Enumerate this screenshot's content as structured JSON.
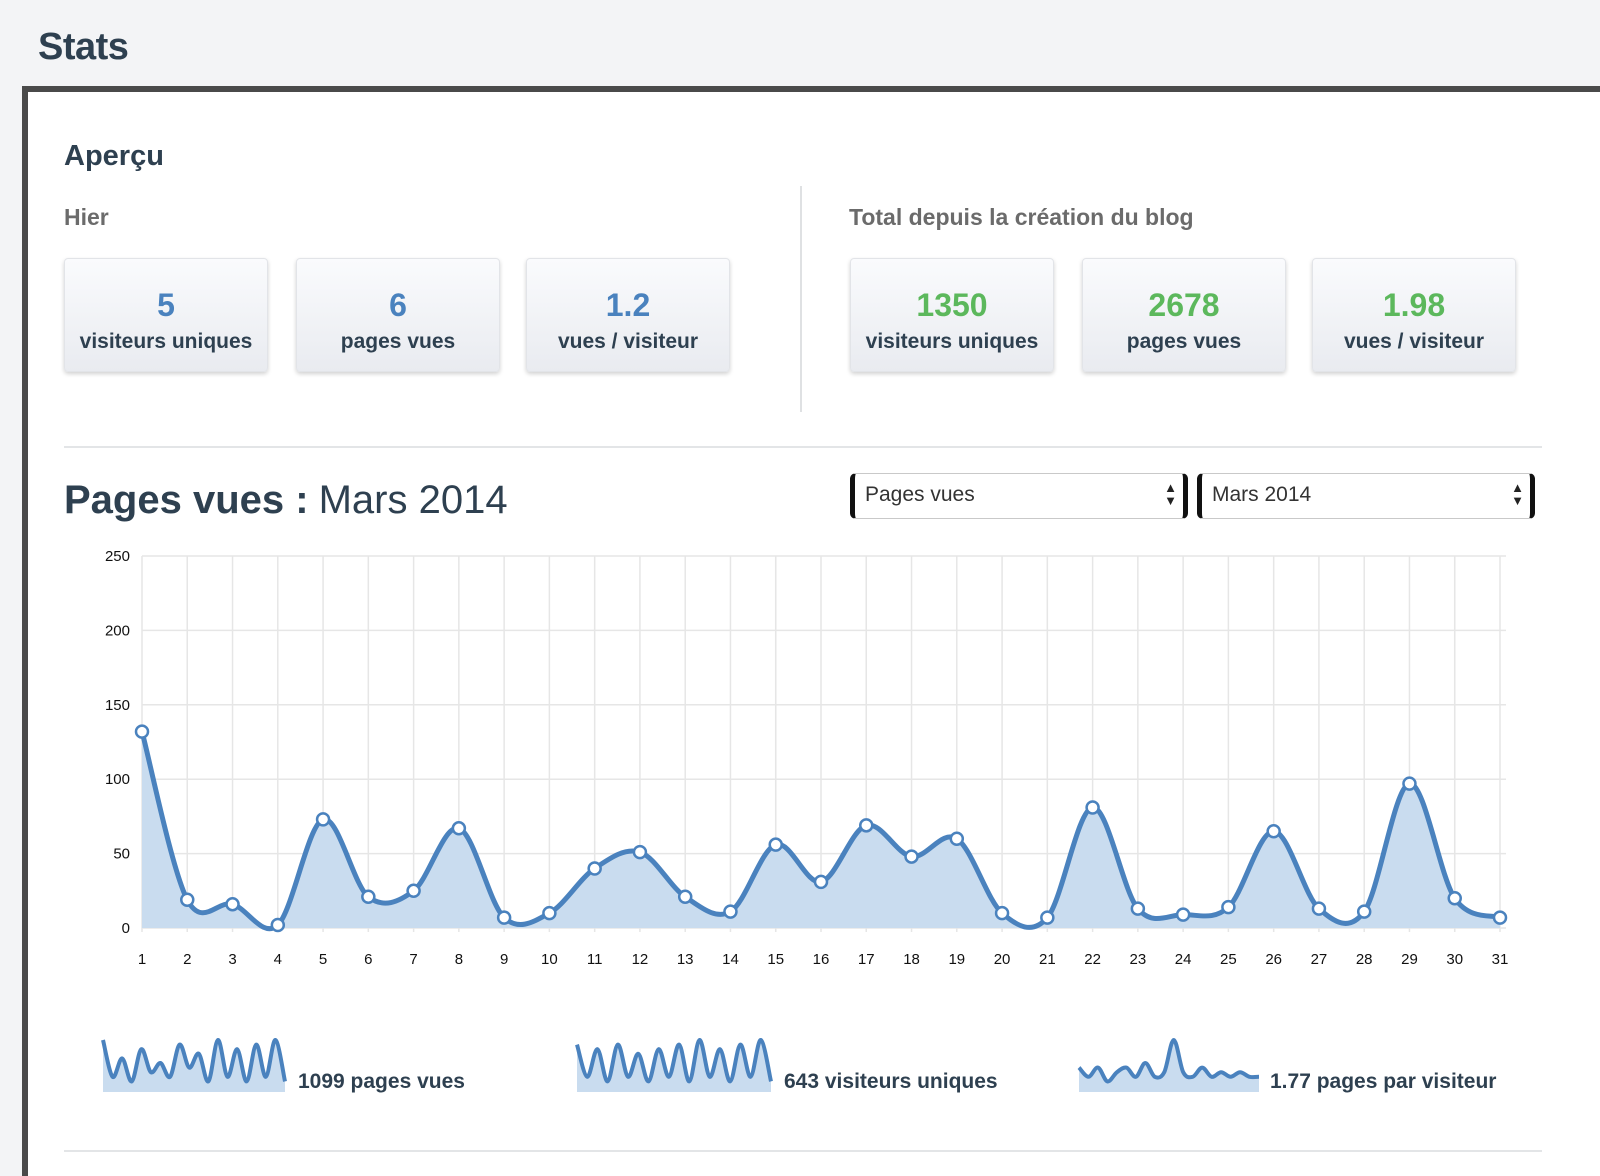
{
  "page": {
    "title": "Stats"
  },
  "overview": {
    "title": "Aperçu",
    "yesterday": {
      "label": "Hier",
      "stats": [
        {
          "value": "5",
          "label": "visiteurs uniques"
        },
        {
          "value": "6",
          "label": "pages vues"
        },
        {
          "value": "1.2",
          "label": "vues / visiteur"
        }
      ]
    },
    "total": {
      "label": "Total depuis la création du blog",
      "stats": [
        {
          "value": "1350",
          "label": "visiteurs uniques"
        },
        {
          "value": "2678",
          "label": "pages vues"
        },
        {
          "value": "1.98",
          "label": "vues / visiteur"
        }
      ]
    }
  },
  "chart_section": {
    "title": "Pages vues :",
    "month": "Mars 2014",
    "metric_select": {
      "selected": "Pages vues"
    },
    "month_select": {
      "selected": "Mars 2014"
    }
  },
  "colors": {
    "accent_blue": "#4a82be",
    "accent_green": "#5cb85c",
    "area_fill": "#c9dcef",
    "grid": "#e6e6e6"
  },
  "chart_data": {
    "type": "area",
    "title": "",
    "xlabel": "",
    "ylabel": "",
    "x": [
      "1",
      "2",
      "3",
      "4",
      "5",
      "6",
      "7",
      "8",
      "9",
      "10",
      "11",
      "12",
      "13",
      "14",
      "15",
      "16",
      "17",
      "18",
      "19",
      "20",
      "21",
      "22",
      "23",
      "24",
      "25",
      "26",
      "27",
      "28",
      "29",
      "30",
      "31"
    ],
    "series": [
      {
        "values": [
          132,
          19,
          16,
          2,
          73,
          21,
          25,
          67,
          7,
          10,
          40,
          51,
          21,
          11,
          56,
          31,
          69,
          48,
          60,
          10,
          7,
          81,
          13,
          9,
          14,
          65,
          13,
          11,
          97,
          20,
          7
        ]
      }
    ],
    "ylim": [
      0,
      250
    ],
    "yticks": [
      0,
      50,
      100,
      150,
      200,
      250
    ],
    "grid": true,
    "legend": "none"
  },
  "sparklines": [
    {
      "label": "1099 pages vues",
      "values": [
        10,
        2,
        6,
        1,
        8,
        3,
        5,
        2,
        9,
        4,
        7,
        1,
        10,
        2,
        8,
        1,
        9,
        2,
        10,
        1
      ]
    },
    {
      "label": "643 visiteurs uniques",
      "values": [
        9,
        2,
        8,
        1,
        9,
        2,
        7,
        1,
        8,
        2,
        9,
        1,
        10,
        2,
        8,
        1,
        9,
        2,
        10,
        1
      ]
    },
    {
      "label": "1.77 pages par visiteur",
      "values": [
        4,
        2,
        4,
        1,
        3,
        4,
        2,
        5,
        2,
        3,
        10,
        3,
        2,
        4,
        2,
        3,
        2,
        3,
        2,
        2
      ]
    }
  ]
}
